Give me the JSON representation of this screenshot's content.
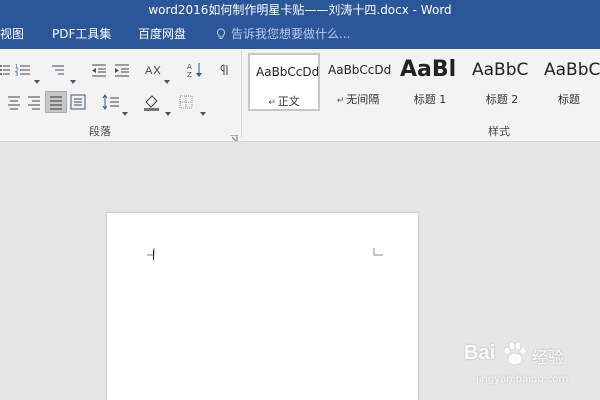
{
  "window": {
    "title": "word2016如何制作明星卡贴——刘涛十四.docx - Word"
  },
  "menu": {
    "tabs": [
      "视图",
      "PDF工具集",
      "百度网盘"
    ],
    "tell_me_placeholder": "告诉我您想要做什么..."
  },
  "ribbon": {
    "groups": {
      "paragraph_label": "段落",
      "styles_label": "样式"
    },
    "styles": [
      {
        "sample": "AaBbCcDd",
        "name": "正文",
        "mark": "↵",
        "selected": true
      },
      {
        "sample": "AaBbCcDd",
        "name": "无间隔",
        "mark": "↵",
        "selected": false
      },
      {
        "sample": "AaBl",
        "name": "标题 1",
        "mark": "",
        "selected": false
      },
      {
        "sample": "AaBbC",
        "name": "标题 2",
        "mark": "",
        "selected": false
      },
      {
        "sample": "AaBbC",
        "name": "标题",
        "mark": "",
        "selected": false
      }
    ]
  },
  "colors": {
    "title_bar": "#2b579a",
    "ribbon_bg": "#f3f3f3",
    "workspace_bg": "#e6e6e6",
    "page_bg": "#ffffff"
  },
  "watermark": {
    "brand": "Bai",
    "product": "经验",
    "url": "jingyan.baidu.com"
  }
}
